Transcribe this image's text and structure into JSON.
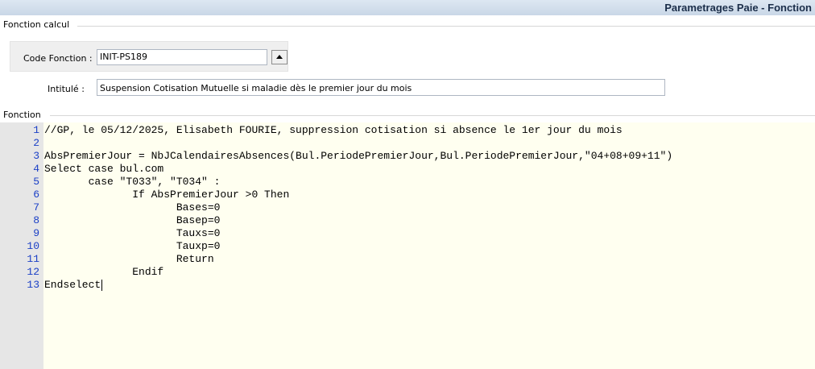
{
  "header": {
    "title": "Parametrages Paie - Fonction"
  },
  "fonction_calcul": {
    "group_label": "Fonction calcul",
    "code_label": "Code Fonction :",
    "code_value": "INIT-PS189",
    "intitule_label": "Intitulé :",
    "intitule_value": "Suspension Cotisation Mutuelle si maladie dès le premier jour du mois"
  },
  "fonction": {
    "group_label": "Fonction",
    "lines": [
      {
        "num": "1",
        "text": "//GP, le 05/12/2025, Elisabeth FOURIE, suppression cotisation si absence le 1er jour du mois"
      },
      {
        "num": "2",
        "text": ""
      },
      {
        "num": "3",
        "text": "AbsPremierJour = NbJCalendairesAbsences(Bul.PeriodePremierJour,Bul.PeriodePremierJour,\"04+08+09+11\")"
      },
      {
        "num": "4",
        "text": "Select case bul.com"
      },
      {
        "num": "5",
        "text": "       case \"T033\", \"T034\" :"
      },
      {
        "num": "6",
        "text": "              If AbsPremierJour >0 Then"
      },
      {
        "num": "7",
        "text": "                     Bases=0"
      },
      {
        "num": "8",
        "text": "                     Basep=0"
      },
      {
        "num": "9",
        "text": "                     Tauxs=0"
      },
      {
        "num": "10",
        "text": "                     Tauxp=0"
      },
      {
        "num": "11",
        "text": "                     Return"
      },
      {
        "num": "12",
        "text": "              Endif"
      },
      {
        "num": "13",
        "text": "Endselect"
      }
    ]
  },
  "colors": {
    "editor_bg": "#fffff0",
    "gutter_bg": "#e6e6e6",
    "line_number": "#1a3fc6"
  }
}
